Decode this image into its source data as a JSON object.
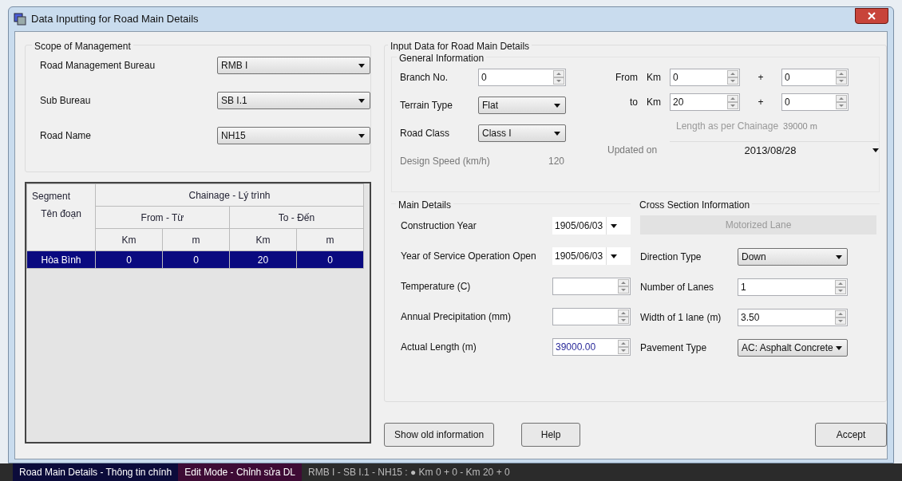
{
  "window": {
    "title": "Data Inputting for Road Main Details"
  },
  "scope": {
    "title": "Scope of Management",
    "fields": [
      {
        "label": "Road Management Bureau",
        "value": "RMB I"
      },
      {
        "label": "Sub Bureau",
        "value": "SB I.1"
      },
      {
        "label": "Road Name",
        "value": "NH15"
      }
    ]
  },
  "segments_table": {
    "header_segment": "Segment",
    "header_segment_vi": "Tên đoạn",
    "header_chainage": "Chainage - Lý trình",
    "header_from": "From - Từ",
    "header_to": "To - Đến",
    "columns": [
      "",
      "Km",
      "m",
      "Km",
      "m"
    ],
    "rows": [
      {
        "cells": [
          "Hòa Bình",
          "0",
          "0",
          "20",
          "0"
        ],
        "selected": true
      }
    ]
  },
  "input_data": {
    "title": "Input Data for Road Main Details",
    "general": {
      "title": "General Information",
      "branch": {
        "label": "Branch No.",
        "value": "0"
      },
      "terrain": {
        "label": "Terrain Type",
        "value": "Flat"
      },
      "road_class": {
        "label": "Road Class",
        "value": "Class I"
      },
      "design_speed": {
        "label": "Design Speed (km/h)",
        "value": "120"
      },
      "from": {
        "label": "From",
        "unit": "Km",
        "km": "0",
        "plus": "+",
        "m": "0"
      },
      "to": {
        "label": "to",
        "unit": "Km",
        "km": "20",
        "plus": "+",
        "m": "0"
      },
      "length": {
        "label": "Length as per Chainage",
        "value": "39000 m"
      },
      "updated": {
        "label": "Updated on",
        "value": "2013/08/28"
      }
    },
    "main": {
      "title": "Main Details",
      "fields": [
        {
          "kind": "date",
          "label": "Construction Year",
          "value": "1905/06/03"
        },
        {
          "kind": "date",
          "label": "Year of Service Operation Open",
          "value": "1905/06/03"
        },
        {
          "kind": "spin",
          "label": "Temperature (C)"
        },
        {
          "kind": "spin",
          "label": "Annual Precipitation (mm)"
        },
        {
          "kind": "spin",
          "label": "Actual Length (m)",
          "value": "39000.00"
        }
      ]
    },
    "cross": {
      "title": "Cross Section Information",
      "tab": "Motorized Lane",
      "fields": [
        {
          "kind": "combo",
          "label": "Direction Type",
          "value": "Down"
        },
        {
          "kind": "spin",
          "label": "Number of Lanes",
          "value": "1"
        },
        {
          "kind": "spin",
          "label": "Width of 1 lane (m)",
          "value": "3.50"
        },
        {
          "kind": "combo",
          "label": "Pavement Type",
          "value": "AC: Asphalt Concrete"
        }
      ]
    }
  },
  "buttons": {
    "show_old": "Show old information",
    "help": "Help",
    "accept": "Accept"
  },
  "status_bar": {
    "section": "Road Main Details - Thông tin chính",
    "mode": "Edit Mode - Chỉnh sửa DL",
    "path": "RMB I - SB I.1 - NH15 : ● Km 0 + 0 - Km 20 + 0"
  }
}
